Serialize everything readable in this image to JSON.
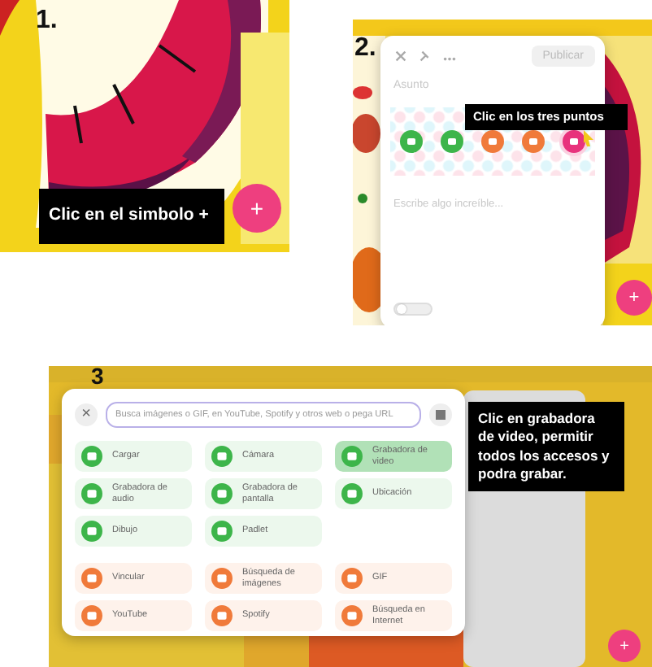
{
  "step1": {
    "number": "1.",
    "caption": "Clic en el simbolo +",
    "fab": "+"
  },
  "step2": {
    "number": "2.",
    "publish": "Publicar",
    "subject_placeholder": "Asunto",
    "caption": "Clic en los tres puntos",
    "attachments": [
      {
        "color": "#3db54a",
        "selected": false
      },
      {
        "color": "#3db54a",
        "selected": false
      },
      {
        "color": "#f07a3a",
        "selected": false
      },
      {
        "color": "#f07a3a",
        "selected": false
      },
      {
        "color": "#e8327c",
        "selected": true
      }
    ],
    "body_placeholder": "Escribe algo increíble...",
    "toggle": {
      "on": false
    },
    "fab": "+"
  },
  "step3": {
    "number": "3",
    "close": "×",
    "search_placeholder": "Busca imágenes o GIF, en YouTube, Spotify y otros web o pega URL",
    "caption": "Clic en grabadora de video, permitir todos los accesos y podra grabar.",
    "fab": "+",
    "groups": [
      {
        "color": "#3db54a",
        "items": [
          {
            "label": "Cargar",
            "selected": false
          },
          {
            "label": "Cámara",
            "selected": false
          },
          {
            "label": "Grabadora de video",
            "selected": true
          },
          {
            "label": "Grabadora de audio",
            "selected": false
          },
          {
            "label": "Grabadora de pantalla",
            "selected": false
          },
          {
            "label": "Ubicación",
            "selected": false
          },
          {
            "label": "Dibujo",
            "selected": false
          },
          {
            "label": "Padlet",
            "selected": false
          }
        ]
      },
      {
        "color": "#f07a3a",
        "items": [
          {
            "label": "Vincular",
            "selected": false
          },
          {
            "label": "Búsqueda de imágenes",
            "selected": false
          },
          {
            "label": "GIF",
            "selected": false
          },
          {
            "label": "YouTube",
            "selected": false
          },
          {
            "label": "Spotify",
            "selected": false
          },
          {
            "label": "Búsqueda en Internet",
            "selected": false
          }
        ]
      }
    ]
  }
}
